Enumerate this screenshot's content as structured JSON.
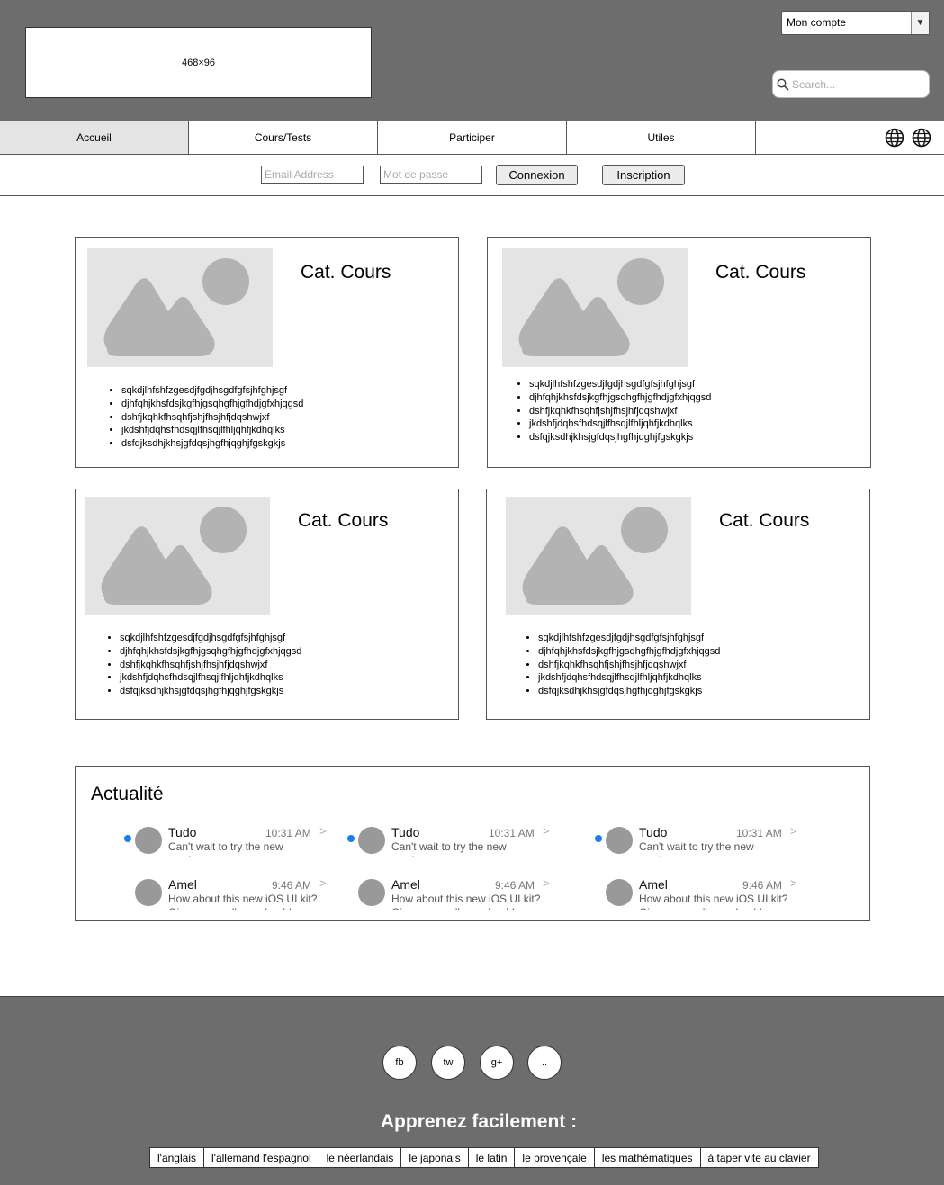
{
  "header": {
    "logo_placeholder": "468×96",
    "account_select": "Mon compte",
    "search_placeholder": "Search..."
  },
  "nav": {
    "tabs": [
      {
        "label": "Accueil",
        "active": true
      },
      {
        "label": "Cours/Tests",
        "active": false
      },
      {
        "label": "Participer",
        "active": false
      },
      {
        "label": "Utiles",
        "active": false
      }
    ],
    "icons": [
      "globe-icon",
      "globe-icon"
    ]
  },
  "login": {
    "email_placeholder": "Email Address",
    "password_placeholder": "Mot de passe",
    "connect_label": "Connexion",
    "register_label": "Inscription"
  },
  "cards": [
    {
      "title": "Cat. Cours",
      "items": [
        "sqkdjlhfshfzgesdjfgdjhsgdfgfsjhfghjsgf",
        "djhfqhjkhsfdsjkgfhjgsqhgfhjgfhdjgfxhjqgsd",
        "dshfjkqhkfhsqhfjshjfhsjhfjdqshwjxf",
        "jkdshfjdqhsfhdsqjlfhsqjlfhljqhfjkdhqlks",
        "dsfqjksdhjkhsjgfdqsjhgfhjqghjfgskgkjs"
      ]
    },
    {
      "title": "Cat. Cours",
      "items": [
        "sqkdjlhfshfzgesdjfgdjhsgdfgfsjhfghjsgf",
        "djhfqhjkhsfdsjkgfhjgsqhgfhjgfhdjgfxhjqgsd",
        "dshfjkqhkfhsqhfjshjfhsjhfjdqshwjxf",
        "jkdshfjdqhsfhdsqjlfhsqjlfhljqhfjkdhqlks",
        "dsfqjksdhjkhsjgfdqsjhgfhjqghjfgskgkjs"
      ]
    },
    {
      "title": "Cat. Cours",
      "items": [
        "sqkdjlhfshfzgesdjfgdjhsgdfgfsjhfghjsgf",
        "djhfqhjkhsfdsjkgfhjgsqhgfhjgfhdjgfxhjqgsd",
        "dshfjkqhkfhsqhfjshjfhsjhfjdqshwjxf",
        "jkdshfjdqhsfhdsqjlfhsqjlfhljqhfjkdhqlks",
        "dsfqjksdhjkhsjgfdqsjhgfhjqghjfgskgkjs"
      ]
    },
    {
      "title": "Cat. Cours",
      "items": [
        "sqkdjlhfshfzgesdjfgdjhsgdfgfsjhfghjsgf",
        "djhfqhjkhsfdsjkgfhjgsqhgfhjgfhdjgfxhjqgsd",
        "dshfjkqhkfhsqhfjshjfhsjhfjdqshwjxf",
        "jkdshfjdqhsfhdsqjlfhsqjlfhljqhfjkdhqlks",
        "dsfqjksdhjkhsjgfdqsjhgfhjqghjfgskgkjs"
      ]
    }
  ],
  "news": {
    "title": "Actualité",
    "messages": [
      {
        "name": "Tudo",
        "time": "10:31 AM",
        "text": "Can't wait to try the new mockups",
        "unread": true
      },
      {
        "name": "Tudo",
        "time": "10:31 AM",
        "text": "Can't wait to try the new mockups",
        "unread": true
      },
      {
        "name": "Tudo",
        "time": "10:31 AM",
        "text": "Can't wait to try the new mockups",
        "unread": true
      },
      {
        "name": "Amelia",
        "time": "9:46 AM",
        "text": "How about this new iOS UI kit? Give me a call, we should",
        "unread": false
      },
      {
        "name": "Amelia",
        "time": "9:46 AM",
        "text": "How about this new iOS UI kit? Give me a call, we should",
        "unread": false
      },
      {
        "name": "Amelia",
        "time": "9:46 AM",
        "text": "How about this new iOS UI kit? Give me a call, we should",
        "unread": false
      }
    ]
  },
  "footer": {
    "social": [
      "fb",
      "tw",
      "g+",
      ".."
    ],
    "title": "Apprenez facilement :",
    "languages": [
      "l'anglais",
      "l'allemand l'espagnol",
      "le néerlandais",
      "le japonais",
      "le latin",
      "le provençale",
      "les mathématiques",
      "à taper vite au clavier"
    ]
  },
  "colors": {
    "header_bg": "#6d6d6d",
    "footer_bg": "#6d6d6d",
    "active_tab_bg": "#e4e4e4",
    "unread_dot": "#1a7cf0",
    "image_placeholder_bg": "#e4e4e4",
    "image_placeholder_shape": "#b3b3b3"
  }
}
